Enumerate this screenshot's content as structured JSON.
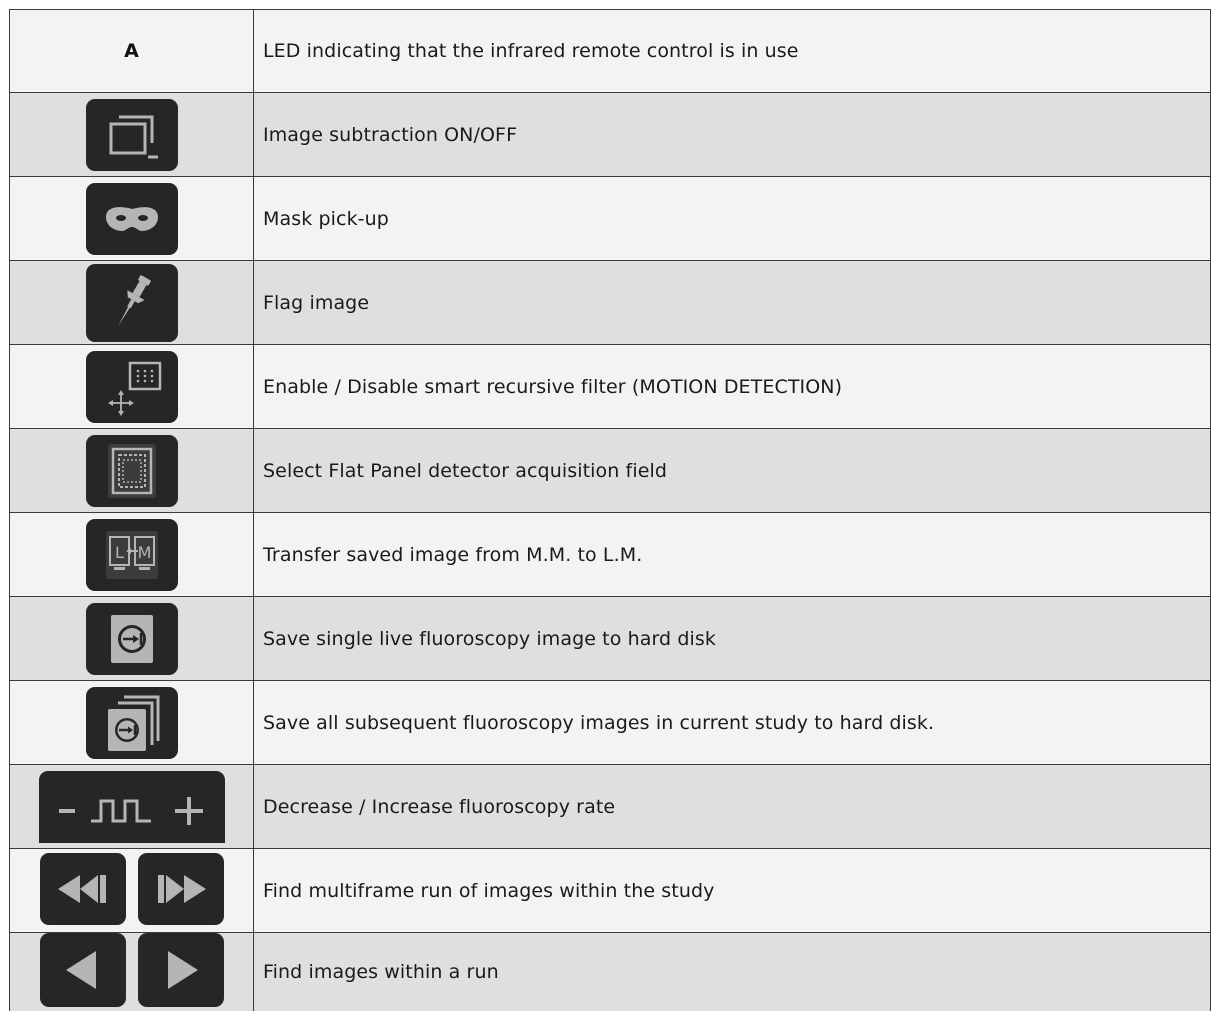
{
  "rows": [
    {
      "key": "A",
      "icon": "led-letter",
      "description": "LED indicating that the infrared remote control is in use"
    },
    {
      "icon": "image-subtraction-icon",
      "description": "Image subtraction ON/OFF"
    },
    {
      "icon": "mask-icon",
      "description": "Mask pick-up"
    },
    {
      "icon": "pushpin-icon",
      "description": "Flag image"
    },
    {
      "icon": "motion-detection-icon",
      "description": "Enable / Disable smart recursive filter (MOTION DETECTION)"
    },
    {
      "icon": "acquisition-field-icon",
      "description": "Select Flat Panel detector acquisition field"
    },
    {
      "icon": "transfer-m-to-l-icon",
      "description": "Transfer saved image from M.M. to L.M."
    },
    {
      "icon": "save-single-icon",
      "description": "Save single live fluoroscopy image to hard disk"
    },
    {
      "icon": "save-all-icon",
      "description": "Save all subsequent fluoroscopy images in current study to hard disk."
    },
    {
      "icon": "pulse-rate-icon",
      "description": "Decrease / Increase fluoroscopy rate"
    },
    {
      "icon": "fast-rewind-forward-icon",
      "description": "Find multiframe run of images within the study"
    },
    {
      "icon": "previous-next-icon",
      "description": "Find images within a run"
    }
  ],
  "colors": {
    "key_background": "#262626",
    "glyph": "#b5b5b5",
    "row_light": "#f3f3f3",
    "row_dark": "#dfdfdf"
  }
}
